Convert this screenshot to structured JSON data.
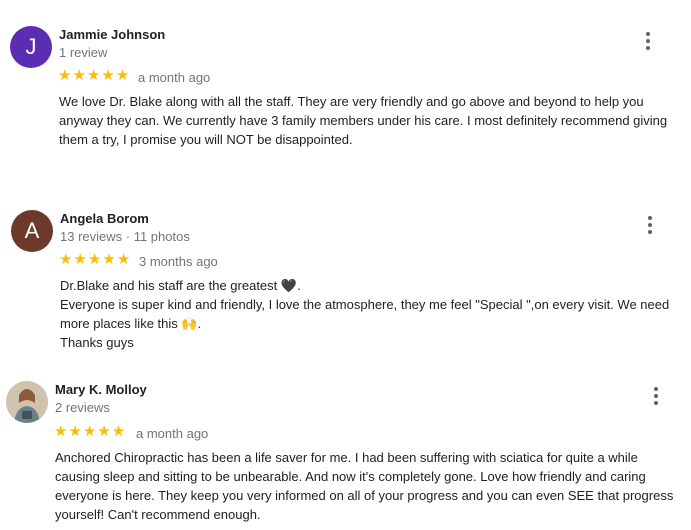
{
  "reviews": [
    {
      "initial": "J",
      "avatar_color": "#5a2db3",
      "name": "Jammie Johnson",
      "meta": "1 review",
      "rating": 5,
      "time": "a month ago",
      "text_lines": [
        "We love Dr. Blake along with all the staff. They are very friendly and go above and beyond to help you anyway they can. We currently have 3 family members under his care. I most definitely recommend giving them a try, I promise you will NOT be disappointed."
      ]
    },
    {
      "initial": "A",
      "avatar_color": "#6b3a2a",
      "name": "Angela Borom",
      "meta": "13 reviews · 11 photos",
      "rating": 5,
      "time": "3 months ago",
      "text_lines": [
        "Dr.Blake and his staff are the greatest 🖤.",
        "Everyone is super kind and friendly, I love the atmosphere, they me feel \"Special \",on every visit. We need more places like this 🙌.",
        "Thanks guys"
      ]
    },
    {
      "initial": "",
      "avatar_color": "#d9cdbd",
      "name": "Mary K. Molloy",
      "meta": "2 reviews",
      "rating": 5,
      "time": "a month ago",
      "text_lines": [
        "Anchored Chiropractic has been a life saver for me. I had been suffering with sciatica for quite a while causing sleep and sitting to be unbearable. And now it's completely gone. Love how friendly and caring everyone is here. They keep you very informed on all of your progress and you can even SEE that progress yourself! Can't recommend enough."
      ]
    }
  ],
  "colors": {
    "star": "#fbbc04",
    "meta": "#70757a",
    "text": "#202124"
  },
  "icons": {
    "star": "star-icon",
    "menu": "more-vert-icon"
  }
}
